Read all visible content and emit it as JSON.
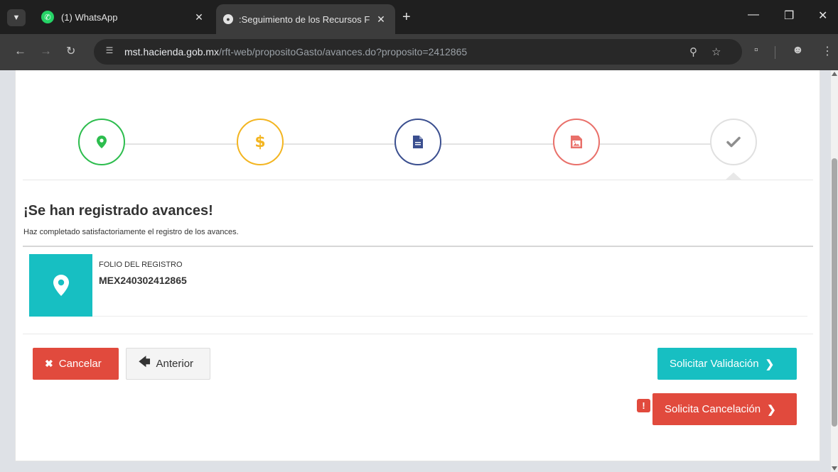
{
  "browser": {
    "tabs": [
      {
        "title": "(1) WhatsApp",
        "active": false
      },
      {
        "title": ":Seguimiento de los Recursos F",
        "active": true
      }
    ],
    "url_host": "mst.hacienda.gob.mx",
    "url_path": "/rft-web/propositoGasto/avances.do?proposito=2412865",
    "icons": {
      "tab_menu": "chevron-down-icon",
      "new_tab": "plus-icon",
      "back": "arrow-left-icon",
      "forward": "arrow-right-icon",
      "reload": "reload-icon",
      "site_info": "tune-icon",
      "zoom": "zoom-icon",
      "bookmark": "star-icon",
      "extensions": "puzzle-icon",
      "profile": "profile-icon",
      "menu": "kebab-menu-icon"
    }
  },
  "stepper": {
    "steps": [
      {
        "icon": "map-marker-icon",
        "color": "#2dbd4e"
      },
      {
        "icon": "dollar-icon",
        "color": "#f3b521"
      },
      {
        "icon": "document-icon",
        "color": "#3b4f8f"
      },
      {
        "icon": "image-icon",
        "color": "#e9706a"
      },
      {
        "icon": "checkmark-icon",
        "color": "#8e8e8e"
      }
    ]
  },
  "main": {
    "heading": "¡Se han registrado avances!",
    "subtext": "Haz completado satisfactoriamente el registro de los avances.",
    "folio_label": "FOLIO DEL REGISTRO",
    "folio_value": "MEX240302412865"
  },
  "buttons": {
    "cancel": "Cancelar",
    "previous": "Anterior",
    "request_validation": "Solicitar Validación",
    "request_cancellation": "Solicita Cancelación"
  },
  "colors": {
    "danger": "#e14a3d",
    "accent": "#17bfc2"
  }
}
